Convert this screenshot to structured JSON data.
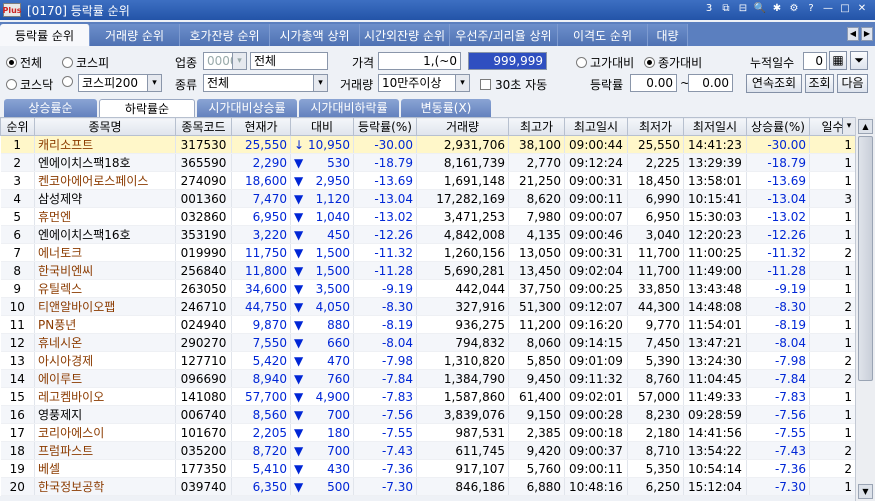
{
  "window": {
    "logo": "Plus",
    "title": "[0170] 등락률 순위",
    "controls": [
      "3",
      "⧉",
      "⊟",
      "🔍",
      "✱",
      "⚙",
      "?",
      "—",
      "□",
      "✕"
    ]
  },
  "main_tabs": [
    "등락률 순위",
    "거래량 순위",
    "호가잔량 순위",
    "시가총액 상위",
    "시간외잔량 순위",
    "우선주/괴리율 상위",
    "이격도 순위",
    "대량"
  ],
  "filters": {
    "market_all": "전체",
    "market_kospi": "코스피",
    "market_kosdaq": "코스닥",
    "index_select": "코스피200",
    "industry_label": "업종",
    "industry_code": "0000",
    "industry_name": "전체",
    "type_label": "종류",
    "type_value": "전체",
    "price_label": "가격",
    "price_from": "1,(~0",
    "price_to": "999,999",
    "volume_label": "거래량",
    "volume_value": "10만주이상",
    "auto_30s": "30초 자동",
    "basis_high": "고가대비",
    "basis_close": "종가대비",
    "rate_label": "등락률",
    "rate_from": "0.00",
    "rate_to": "0.00",
    "tilde": "~",
    "days_label": "누적일수",
    "days_value": "0",
    "btn_continuous": "연속조회",
    "btn_query": "조회",
    "btn_next": "다음"
  },
  "sub_tabs": [
    "상승률순",
    "하락률순",
    "시가대비상승률",
    "시가대비하락률",
    "변동률(X)"
  ],
  "table": {
    "headers": [
      "순위",
      "종목명",
      "종목코드",
      "현재가",
      "대비",
      "등락률(%)",
      "거래량",
      "최고가",
      "최고일시",
      "최저가",
      "최저일시",
      "상승률(%)",
      "일수"
    ],
    "rows": [
      [
        "1",
        "캐리소프트",
        "317530",
        "25,550",
        "↓",
        "10,950",
        "-30.00",
        "2,931,706",
        "38,100",
        "09:00:44",
        "25,550",
        "14:41:23",
        "-30.00",
        "1"
      ],
      [
        "2",
        "엔에이치스팩18호",
        "365590",
        "2,290",
        "▼",
        "530",
        "-18.79",
        "8,161,739",
        "2,770",
        "09:12:24",
        "2,225",
        "13:29:39",
        "-18.79",
        "1"
      ],
      [
        "3",
        "켄코아에어로스페이스",
        "274090",
        "18,600",
        "▼",
        "2,950",
        "-13.69",
        "1,691,148",
        "21,250",
        "09:00:31",
        "18,450",
        "13:58:01",
        "-13.69",
        "1"
      ],
      [
        "4",
        "삼성제약",
        "001360",
        "7,470",
        "▼",
        "1,120",
        "-13.04",
        "17,282,169",
        "8,620",
        "09:00:11",
        "6,990",
        "10:15:41",
        "-13.04",
        "3"
      ],
      [
        "5",
        "휴먼엔",
        "032860",
        "6,950",
        "▼",
        "1,040",
        "-13.02",
        "3,471,253",
        "7,980",
        "09:00:07",
        "6,950",
        "15:30:03",
        "-13.02",
        "1"
      ],
      [
        "6",
        "엔에이치스팩16호",
        "353190",
        "3,220",
        "▼",
        "450",
        "-12.26",
        "4,842,008",
        "4,135",
        "09:00:46",
        "3,040",
        "12:20:23",
        "-12.26",
        "1"
      ],
      [
        "7",
        "에너토크",
        "019990",
        "11,750",
        "▼",
        "1,500",
        "-11.32",
        "1,260,156",
        "13,050",
        "09:00:31",
        "11,700",
        "11:00:25",
        "-11.32",
        "2"
      ],
      [
        "8",
        "한국비엔씨",
        "256840",
        "11,800",
        "▼",
        "1,500",
        "-11.28",
        "5,690,281",
        "13,450",
        "09:02:04",
        "11,700",
        "11:49:00",
        "-11.28",
        "1"
      ],
      [
        "9",
        "유틸렉스",
        "263050",
        "34,600",
        "▼",
        "3,500",
        "-9.19",
        "442,044",
        "37,750",
        "09:00:25",
        "33,850",
        "13:43:48",
        "-9.19",
        "1"
      ],
      [
        "10",
        "티앤알바이오팹",
        "246710",
        "44,750",
        "▼",
        "4,050",
        "-8.30",
        "327,916",
        "51,300",
        "09:12:07",
        "44,300",
        "14:48:08",
        "-8.30",
        "2"
      ],
      [
        "11",
        "PN풍년",
        "024940",
        "9,870",
        "▼",
        "880",
        "-8.19",
        "936,275",
        "11,200",
        "09:16:20",
        "9,770",
        "11:54:01",
        "-8.19",
        "1"
      ],
      [
        "12",
        "휴네시온",
        "290270",
        "7,550",
        "▼",
        "660",
        "-8.04",
        "794,832",
        "8,060",
        "09:14:15",
        "7,450",
        "13:47:21",
        "-8.04",
        "1"
      ],
      [
        "13",
        "아시아경제",
        "127710",
        "5,420",
        "▼",
        "470",
        "-7.98",
        "1,310,820",
        "5,850",
        "09:01:09",
        "5,390",
        "13:24:30",
        "-7.98",
        "2"
      ],
      [
        "14",
        "에이루트",
        "096690",
        "8,940",
        "▼",
        "760",
        "-7.84",
        "1,384,790",
        "9,450",
        "09:11:32",
        "8,760",
        "11:04:45",
        "-7.84",
        "2"
      ],
      [
        "15",
        "레고켐바이오",
        "141080",
        "57,700",
        "▼",
        "4,900",
        "-7.83",
        "1,587,860",
        "61,400",
        "09:02:01",
        "57,000",
        "11:49:33",
        "-7.83",
        "1"
      ],
      [
        "16",
        "영풍제지",
        "006740",
        "8,560",
        "▼",
        "700",
        "-7.56",
        "3,839,076",
        "9,150",
        "09:00:28",
        "8,230",
        "09:28:59",
        "-7.56",
        "1"
      ],
      [
        "17",
        "코리아에스이",
        "101670",
        "2,205",
        "▼",
        "180",
        "-7.55",
        "987,531",
        "2,385",
        "09:00:18",
        "2,180",
        "14:41:56",
        "-7.55",
        "1"
      ],
      [
        "18",
        "프럼파스트",
        "035200",
        "8,720",
        "▼",
        "700",
        "-7.43",
        "611,745",
        "9,420",
        "09:00:37",
        "8,710",
        "13:54:22",
        "-7.43",
        "2"
      ],
      [
        "19",
        "베셀",
        "177350",
        "5,410",
        "▼",
        "430",
        "-7.36",
        "917,107",
        "5,760",
        "09:00:11",
        "5,350",
        "10:54:14",
        "-7.36",
        "2"
      ],
      [
        "20",
        "한국정보공학",
        "039740",
        "6,350",
        "▼",
        "500",
        "-7.30",
        "846,186",
        "6,880",
        "10:48:16",
        "6,250",
        "15:12:04",
        "-7.30",
        "1"
      ]
    ],
    "kosdaq_rows": [
      0,
      2,
      4,
      6,
      7,
      8,
      9,
      10,
      11,
      12,
      13,
      14,
      16,
      17,
      18,
      19
    ]
  },
  "colors": {
    "down": "#0026d6",
    "kosdaq_name": "#8b3b00",
    "selected_row": "#fff7c9",
    "title_bar": "#2f60b5"
  }
}
